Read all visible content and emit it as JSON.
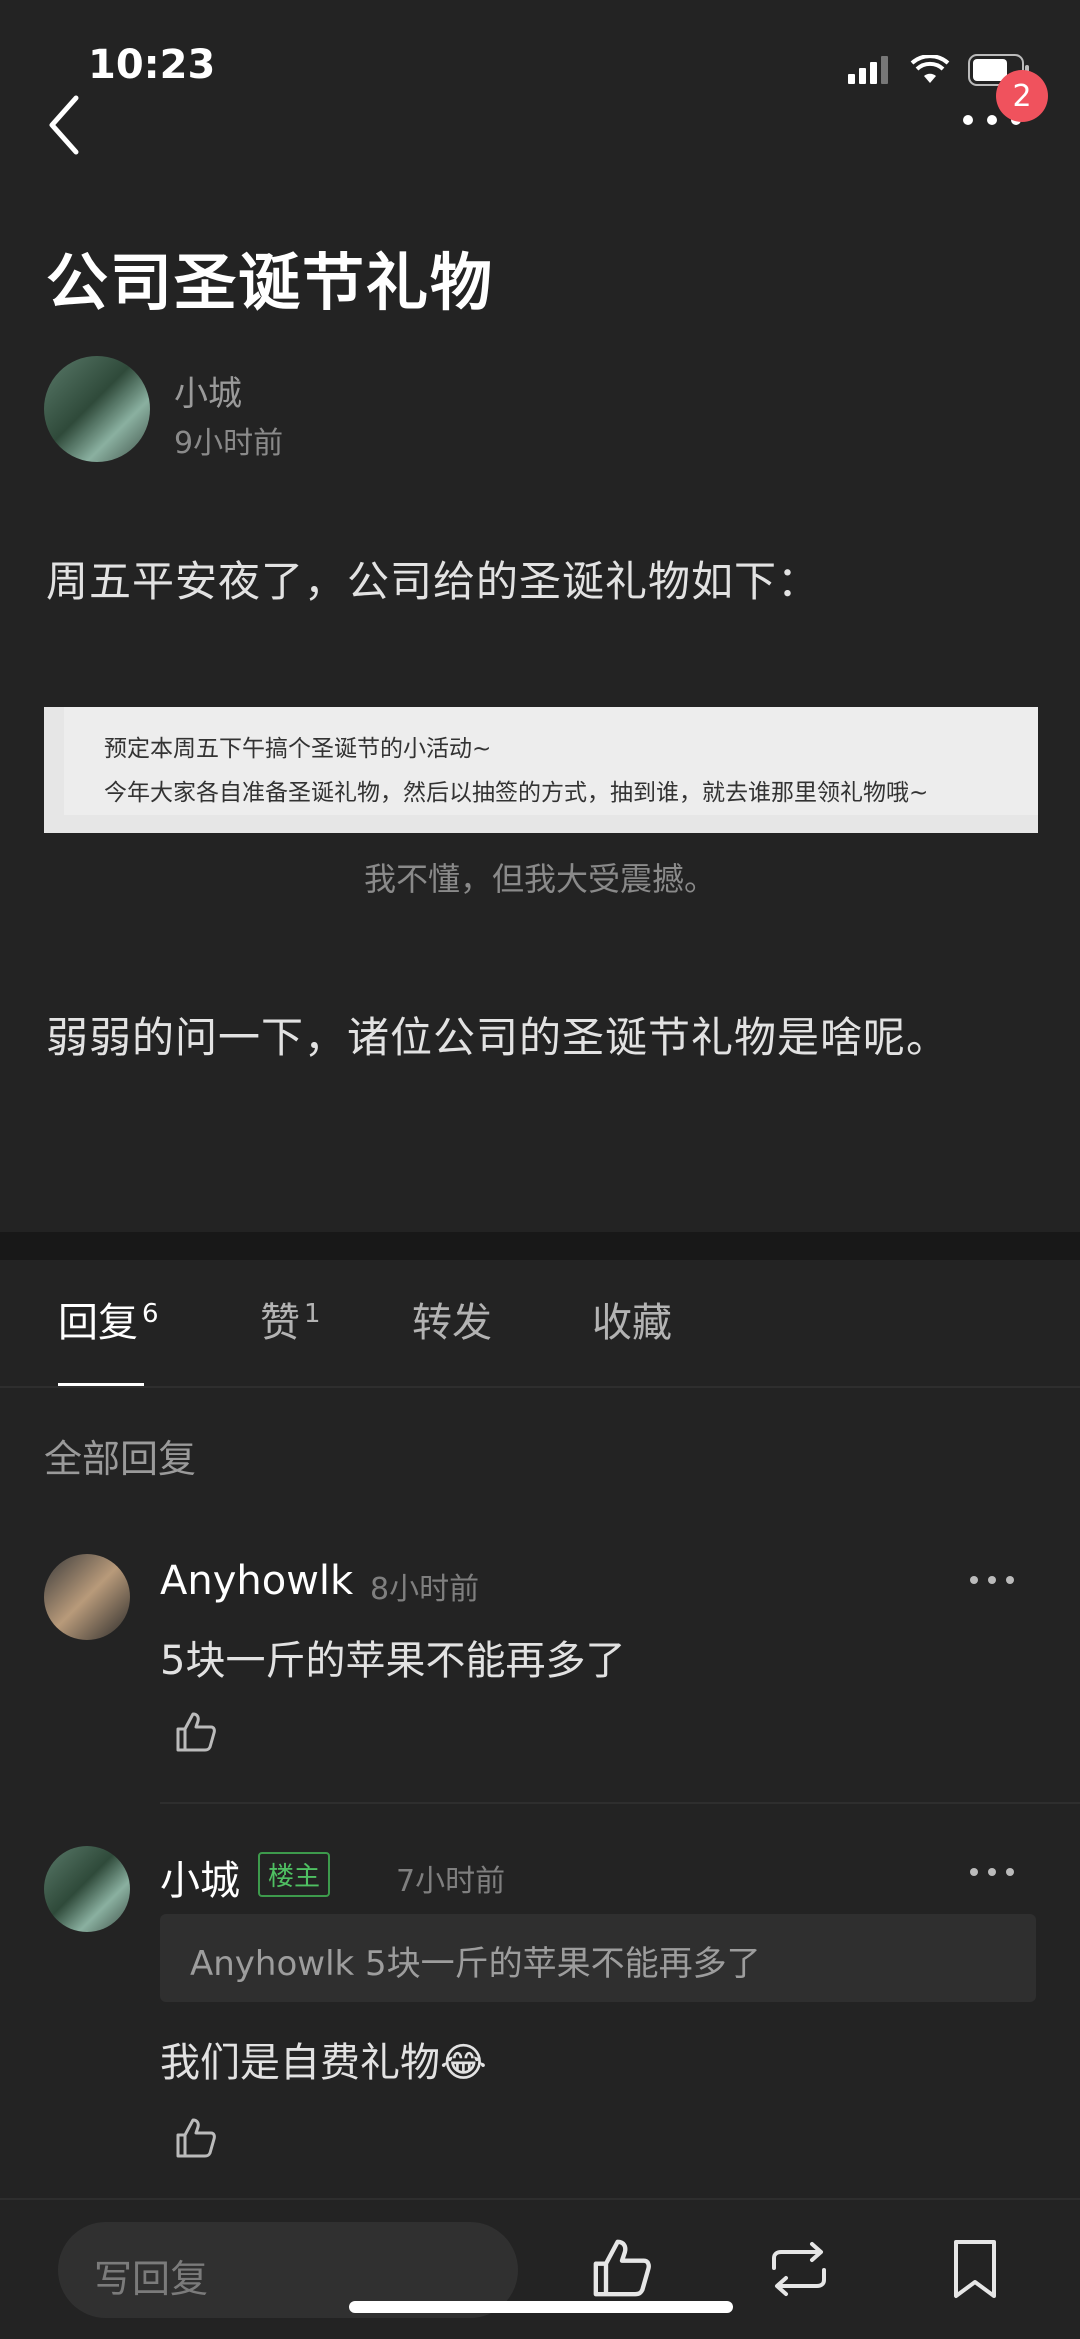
{
  "status_bar": {
    "time": "10:23",
    "notification_count": "2"
  },
  "post": {
    "title": "公司圣诞节礼物",
    "author": "小城",
    "time": "9小时前",
    "paragraph1": "周五平安夜了，公司给的圣诞礼物如下：",
    "image_lines": [
      "预定本周五下午搞个圣诞节的小活动~",
      "今年大家各自准备圣诞礼物，然后以抽签的方式，抽到谁，就去谁那里领礼物哦~"
    ],
    "image_caption": "我不懂，但我大受震撼。",
    "paragraph2": "弱弱的问一下，诸位公司的圣诞节礼物是啥呢。"
  },
  "tabs": [
    {
      "label": "回复",
      "count": "6"
    },
    {
      "label": "赞",
      "count": "1"
    },
    {
      "label": "转发",
      "count": ""
    },
    {
      "label": "收藏",
      "count": ""
    }
  ],
  "section_label": "全部回复",
  "comments": [
    {
      "name": "Anyhowlk",
      "time": "8小时前",
      "text": "5块一斤的苹果不能再多了"
    },
    {
      "name": "小城",
      "tag": "楼主",
      "time": "7小时前",
      "quote": "Anyhowlk 5块一斤的苹果不能再多了",
      "text": "我们是自费礼物😂"
    }
  ],
  "bottom_bar": {
    "reply_placeholder": "写回复"
  }
}
